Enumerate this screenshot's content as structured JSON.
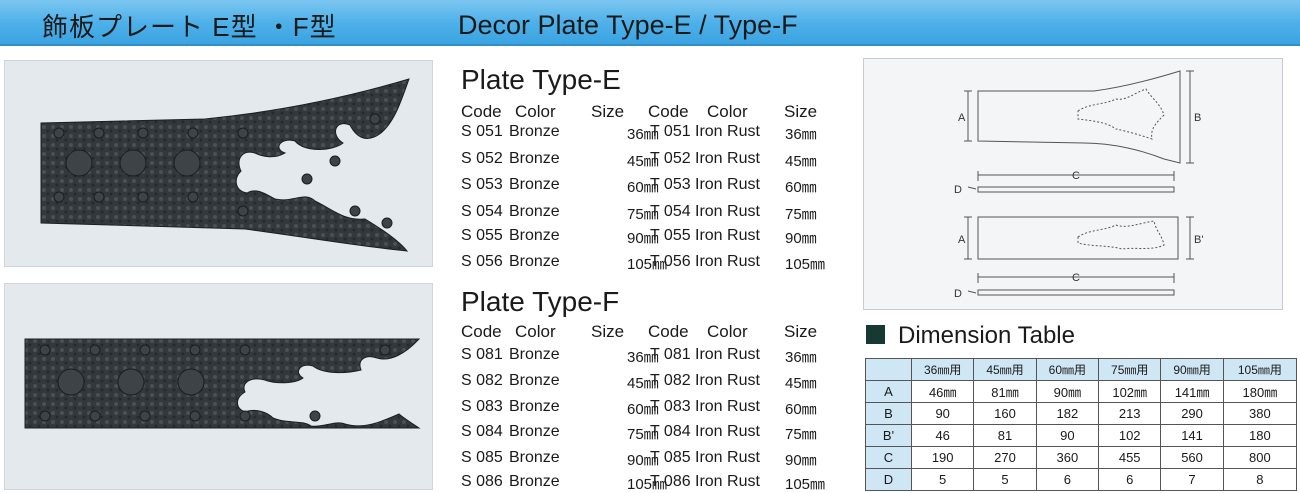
{
  "header": {
    "title_jp": "飾板プレート E型 ・F型",
    "title_en": "Decor Plate Type-E / Type-F"
  },
  "plate_e": {
    "title": "Plate Type-E",
    "headers": [
      "Code",
      "Color",
      "Size",
      "Code",
      "Color",
      "Size"
    ],
    "rows": [
      [
        "S 051",
        "Bronze",
        "36㎜",
        "T 051",
        "Iron Rust",
        "36㎜"
      ],
      [
        "S 052",
        "Bronze",
        "45㎜",
        "T 052",
        "Iron Rust",
        "45㎜"
      ],
      [
        "S 053",
        "Bronze",
        "60㎜",
        "T 053",
        "Iron Rust",
        "60㎜"
      ],
      [
        "S 054",
        "Bronze",
        "75㎜",
        "T 054",
        "Iron Rust",
        "75㎜"
      ],
      [
        "S 055",
        "Bronze",
        "90㎜",
        "T 055",
        "Iron Rust",
        "90㎜"
      ],
      [
        "S 056",
        "Bronze",
        "105㎜",
        "T 056",
        "Iron Rust",
        "105㎜"
      ]
    ]
  },
  "plate_f": {
    "title": "Plate Type-F",
    "headers": [
      "Code",
      "Color",
      "Size",
      "Code",
      "Color",
      "Size"
    ],
    "rows": [
      [
        "S 081",
        "Bronze",
        "36㎜",
        "T 081",
        "Iron Rust",
        "36㎜"
      ],
      [
        "S 082",
        "Bronze",
        "45㎜",
        "T 082",
        "Iron Rust",
        "45㎜"
      ],
      [
        "S 083",
        "Bronze",
        "60㎜",
        "T 083",
        "Iron Rust",
        "60㎜"
      ],
      [
        "S 084",
        "Bronze",
        "75㎜",
        "T 084",
        "Iron Rust",
        "75㎜"
      ],
      [
        "S 085",
        "Bronze",
        "90㎜",
        "T 085",
        "Iron Rust",
        "90㎜"
      ],
      [
        "S 086",
        "Bronze",
        "105㎜",
        "T 086",
        "Iron Rust",
        "105㎜"
      ]
    ]
  },
  "diagram": {
    "labels_e": [
      "A",
      "B",
      "C",
      "D"
    ],
    "labels_f": [
      "A",
      "B'",
      "C",
      "D"
    ]
  },
  "dimension_table": {
    "title": "Dimension Table",
    "columns": [
      "36㎜用",
      "45㎜用",
      "60㎜用",
      "75㎜用",
      "90㎜用",
      "105㎜用"
    ],
    "rows": [
      {
        "label": "A",
        "values": [
          "46㎜",
          "81㎜",
          "90㎜",
          "102㎜",
          "141㎜",
          "180㎜"
        ]
      },
      {
        "label": "B",
        "values": [
          "90",
          "160",
          "182",
          "213",
          "290",
          "380"
        ]
      },
      {
        "label": "B'",
        "values": [
          "46",
          "81",
          "90",
          "102",
          "141",
          "180"
        ]
      },
      {
        "label": "C",
        "values": [
          "190",
          "270",
          "360",
          "455",
          "560",
          "800"
        ]
      },
      {
        "label": "D",
        "values": [
          "5",
          "5",
          "6",
          "6",
          "7",
          "8"
        ]
      }
    ]
  },
  "colors": {
    "header_blue": "#4fb1ea",
    "table_header_blue": "#cfe6f4",
    "plate_dark": "#2e3236",
    "square_mark": "#163a33"
  }
}
